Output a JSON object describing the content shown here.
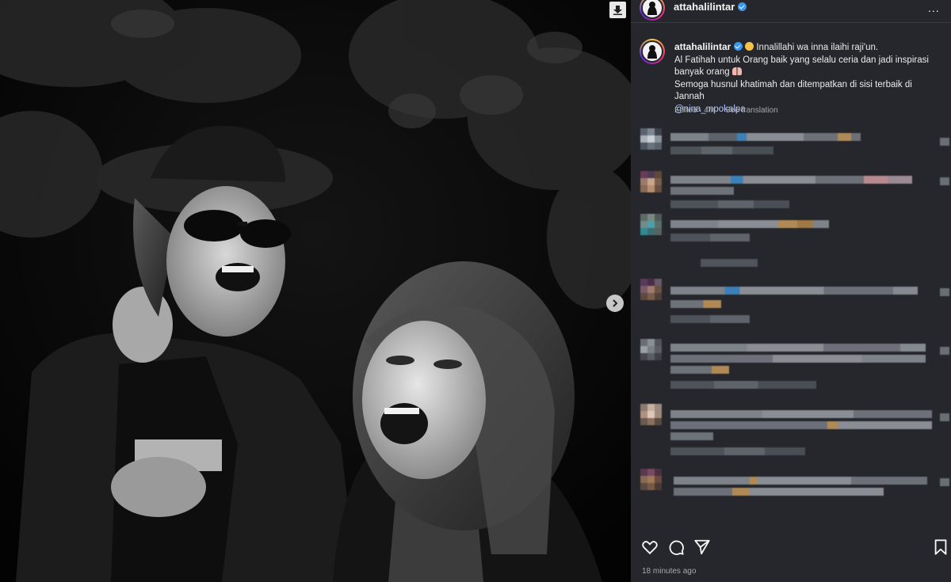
{
  "media": {
    "download_icon": "download-icon",
    "next_icon": "chevron-right-icon"
  },
  "header": {
    "username": "attahalilintar",
    "verified_icon": "verified-badge-icon",
    "more_icon": "more-horizontal-icon",
    "more_label": "..."
  },
  "caption": {
    "username": "attahalilintar",
    "line1": "Innalillahi wa inna ilaihi raji'un.",
    "line2": "Al Fatihah untuk Orang baik yang selalu ceria dan jadi inspirasi banyak orang",
    "line3": "Semoga husnul khatimah dan ditempatkan di sisi terbaik di Jannah",
    "mention": "@nina_mpokalpa",
    "edited": "Edited · 4m",
    "see_translation": "See translation"
  },
  "actions": {
    "like_icon": "heart-icon",
    "comment_icon": "comment-icon",
    "share_icon": "send-icon",
    "save_icon": "bookmark-icon",
    "time_ago": "18 minutes ago"
  },
  "colors": {
    "sidebar_bg": "#25272c",
    "media_bg": "#000000",
    "mention": "#b3c9ff",
    "verified": "#3897f0",
    "muted_text": "#a8a8a8"
  }
}
